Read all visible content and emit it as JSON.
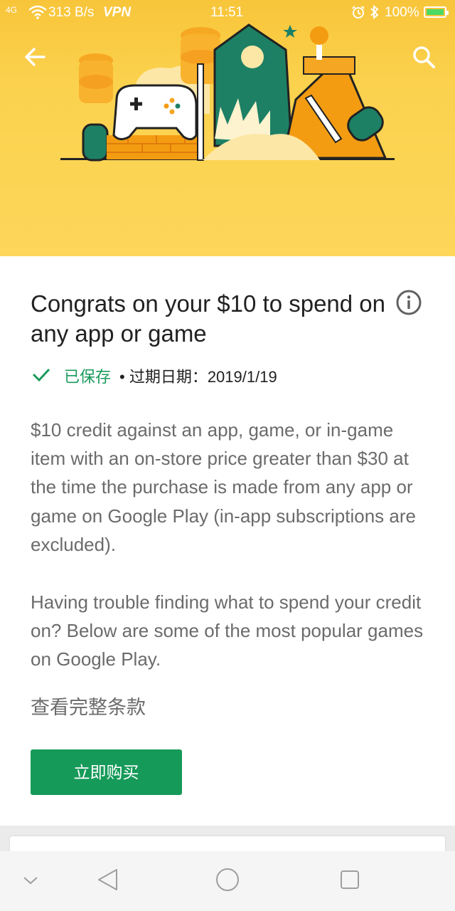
{
  "status_bar": {
    "network": "4G",
    "wifi_speed": "313 B/s",
    "vpn": "VPN",
    "time": "11:51",
    "battery": "100%"
  },
  "header": {
    "back_icon": "arrow-left-icon",
    "search_icon": "search-icon",
    "banner_color": "#fbd24e"
  },
  "offer": {
    "title": "Congrats on your $10 to spend on any app or game",
    "saved_label": "已保存",
    "expiry": "• 过期日期：2019/1/19",
    "description": "$10 credit against an app, game, or in-game item with an on-store price greater than $30 at the time the purchase is made from any app or game on Google Play (in-app subscriptions are excluded).",
    "suggestion": "Having trouble finding what to spend your credit on? Below are some of the most popular games on Google Play.",
    "terms_link": "查看完整条款",
    "buy_button": "立即购买",
    "accent_color": "#169a59"
  },
  "nav_bar": {
    "items": [
      "chevron-down-icon",
      "back-triangle-icon",
      "home-circle-icon",
      "recents-square-icon"
    ]
  }
}
